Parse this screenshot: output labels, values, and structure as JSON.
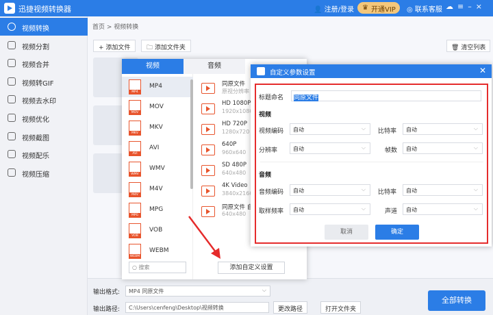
{
  "app": {
    "title": "迅捷视频转换器",
    "login": "注册/登录",
    "vip": "开通VIP",
    "service": "联系客服"
  },
  "colors": {
    "accent": "#2b7de6",
    "vip_bg": "#f3c77b",
    "format_icon": "#e8542c",
    "highlight_box": "#e52b2b"
  },
  "sidebar": {
    "items": [
      {
        "label": "视频转换",
        "icon": "video-convert-icon",
        "active": true
      },
      {
        "label": "视频分割",
        "icon": "split-icon"
      },
      {
        "label": "视频合并",
        "icon": "merge-icon"
      },
      {
        "label": "视频转GIF",
        "icon": "gif-icon"
      },
      {
        "label": "视频去水印",
        "icon": "watermark-icon"
      },
      {
        "label": "视频优化",
        "icon": "optimize-icon"
      },
      {
        "label": "视频截图",
        "icon": "screenshot-icon"
      },
      {
        "label": "视频配乐",
        "icon": "music-icon"
      },
      {
        "label": "视频压缩",
        "icon": "compress-icon"
      }
    ]
  },
  "main": {
    "breadcrumb": "首页 > 视频转换",
    "add_file": "+ 添加文件",
    "add_folder": "添加文件夹",
    "clear": "清空列表"
  },
  "bottom": {
    "format_label": "输出格式:",
    "format_value": "MP4  同原文件",
    "path_label": "输出路径:",
    "path_value": "C:\\Users\\cenfeng\\Desktop\\视频转换",
    "change_path": "更改路径",
    "open_folder": "打开文件夹",
    "convert_all": "全部转换"
  },
  "format_panel": {
    "tabs": [
      "视频",
      "音频"
    ],
    "formats": [
      "MP4",
      "MOV",
      "MKV",
      "AVI",
      "WMV",
      "M4V",
      "MPG",
      "VOB",
      "WEBM"
    ],
    "presets": [
      {
        "name": "同原文件",
        "sub": "原视分辨率"
      },
      {
        "name": "HD 1080P",
        "sub": "1920x1080"
      },
      {
        "name": "HD 720P",
        "sub": "1280x720"
      },
      {
        "name": "640P",
        "sub": "960x640"
      },
      {
        "name": "SD 480P",
        "sub": "640x480"
      },
      {
        "name": "4K Video",
        "sub": "3840x2160"
      },
      {
        "name": "同原文件 自",
        "sub": "640x480"
      }
    ],
    "search_placeholder": "搜索",
    "add_custom": "添加自定义设置"
  },
  "dialog": {
    "title": "自定义参数设置",
    "name_label": "标题命名",
    "name_value": "同原文件",
    "video_section": "视频",
    "video_codec_label": "视频编码",
    "video_codec": "自动",
    "bitrate_label": "比特率",
    "bitrate": "自动",
    "resolution_label": "分辨率",
    "resolution": "自动",
    "fps_label": "帧数",
    "fps": "自动",
    "audio_section": "音频",
    "audio_codec_label": "音频编码",
    "audio_codec": "自动",
    "audio_bitrate_label": "比特率",
    "audio_bitrate": "自动",
    "samplerate_label": "取样频率",
    "samplerate": "自动",
    "channels_label": "声道",
    "channels": "自动",
    "cancel": "取消",
    "ok": "确定"
  }
}
